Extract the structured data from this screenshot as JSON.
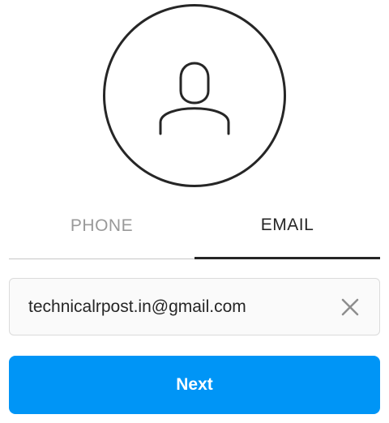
{
  "avatar": {
    "icon": "user-icon"
  },
  "tabs": [
    {
      "label": "PHONE",
      "active": false
    },
    {
      "label": "EMAIL",
      "active": true
    }
  ],
  "email_field": {
    "value": "technicalrpost.in@gmail.com",
    "clear_icon": "close-icon"
  },
  "next_button": {
    "label": "Next"
  },
  "colors": {
    "primary": "#0095f6",
    "text": "#262626",
    "muted": "#999999",
    "border": "#dbdbdb",
    "field_bg": "#fafafa"
  }
}
